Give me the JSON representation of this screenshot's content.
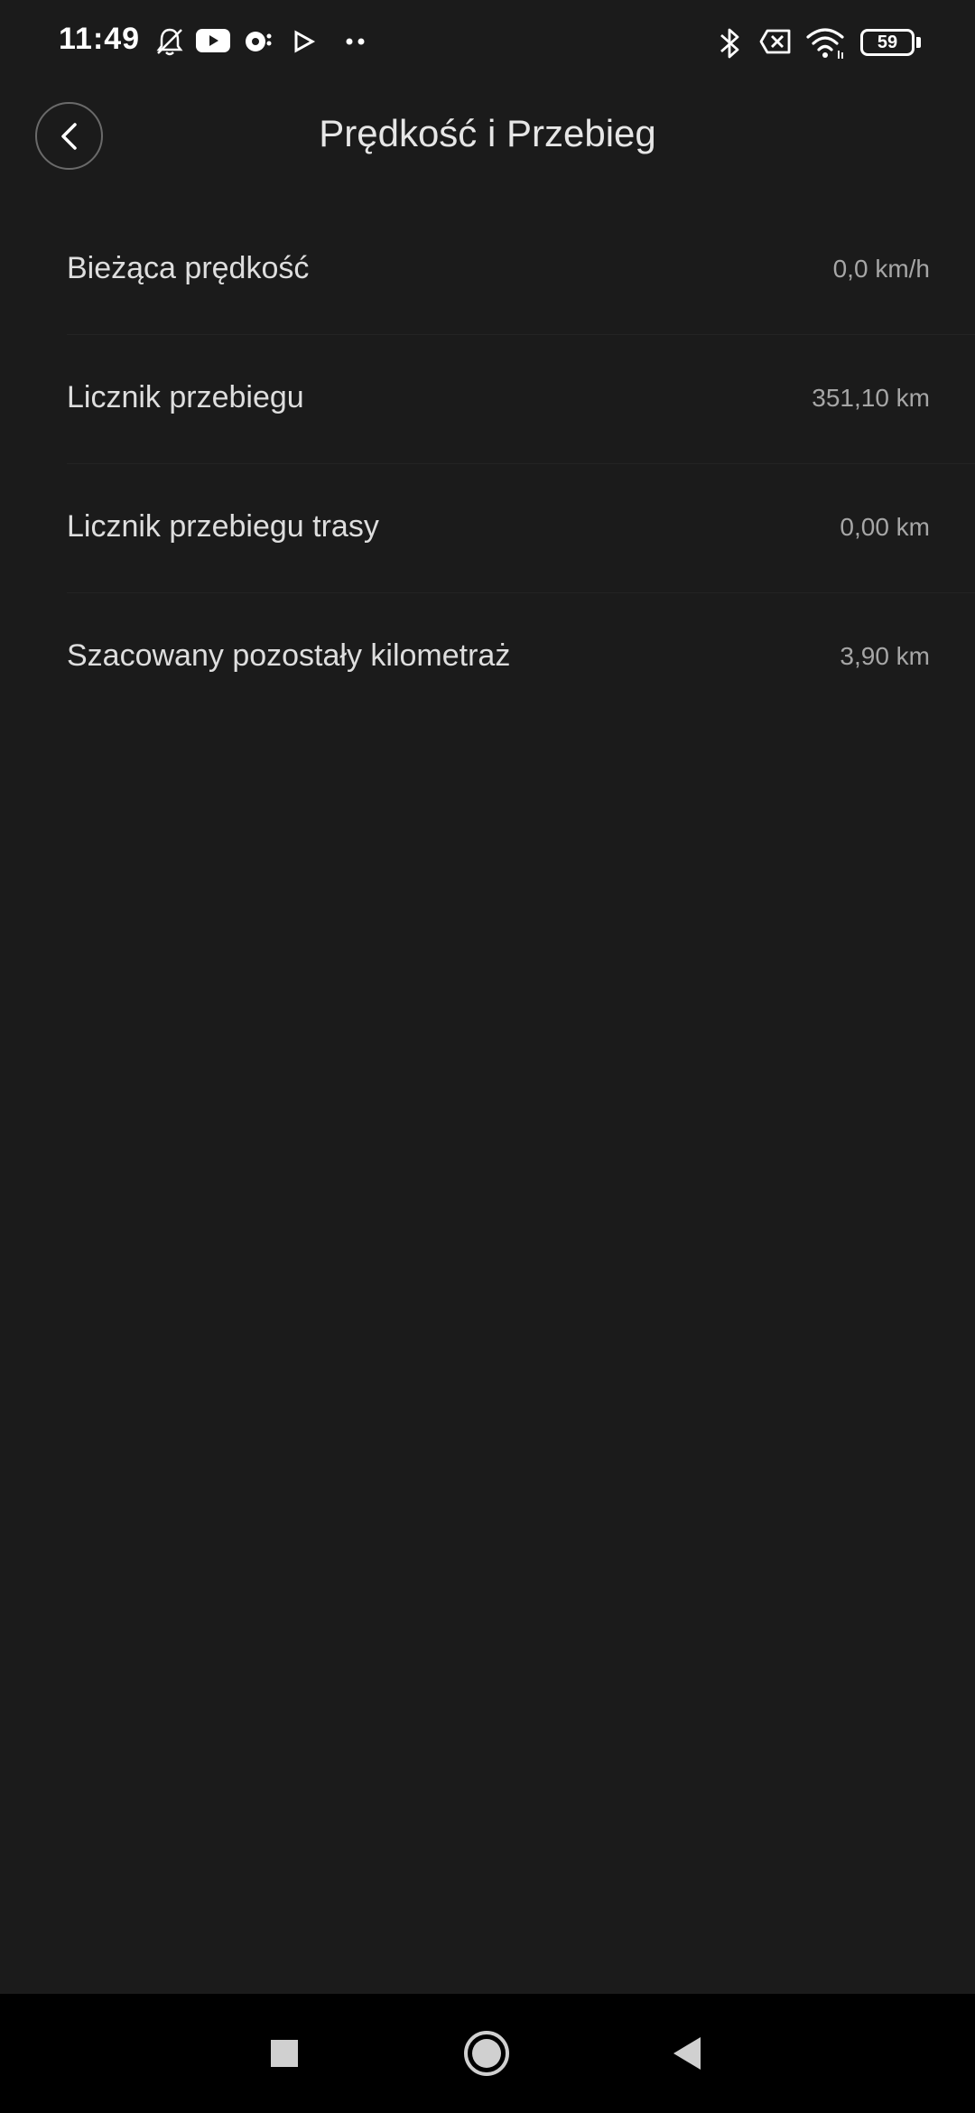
{
  "status_bar": {
    "time": "11:49",
    "battery": "59",
    "left_icons": [
      "bell-off-icon",
      "youtube-icon",
      "app-notification-icon",
      "play-store-icon",
      "more-dots-icon"
    ],
    "right_icons": [
      "bluetooth-icon",
      "no-sim-icon",
      "wifi-icon",
      "battery-icon"
    ]
  },
  "header": {
    "title": "Prędkość i Przebieg",
    "back_icon": "chevron-left-icon"
  },
  "items": [
    {
      "label": "Bieżąca prędkość",
      "value": "0,0 km/h"
    },
    {
      "label": "Licznik przebiegu",
      "value": "351,10 km"
    },
    {
      "label": "Licznik przebiegu trasy",
      "value": "0,00 km"
    },
    {
      "label": "Szacowany pozostały kilometraż",
      "value": "3,90 km"
    }
  ],
  "nav_bar": {
    "buttons": [
      "recents-square-icon",
      "home-circle-icon",
      "back-triangle-icon"
    ]
  },
  "colors": {
    "background": "#1b1b1b",
    "text_primary": "#e6e6e6",
    "text_secondary": "#a6a6a6",
    "nav_background": "#000000"
  }
}
